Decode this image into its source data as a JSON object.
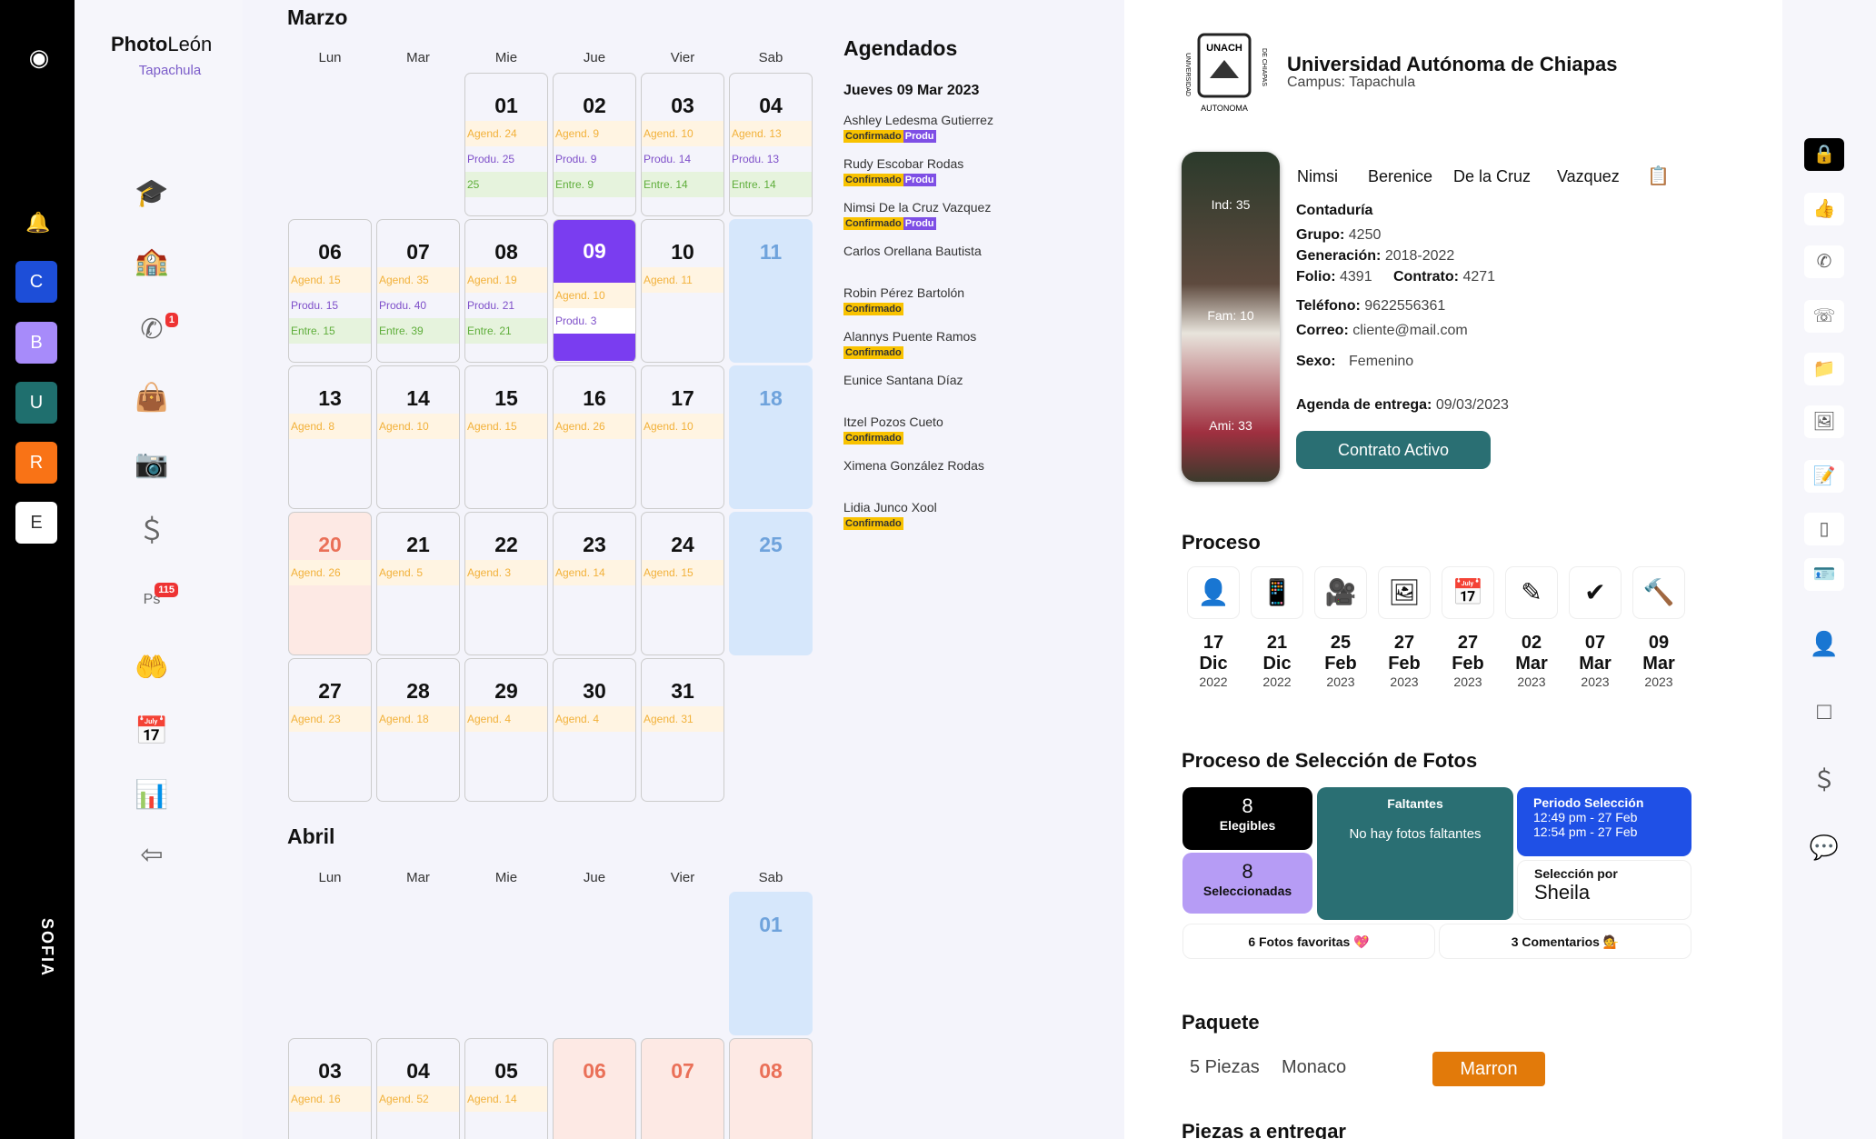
{
  "rail": {
    "logo_icon": "camera-lens-icon",
    "workspaces": [
      {
        "label": "C",
        "color": "#1d4ed8"
      },
      {
        "label": "B",
        "color": "#a78bfa"
      },
      {
        "label": "U",
        "color": "#1f6f6e"
      },
      {
        "label": "R",
        "color": "#f97316"
      },
      {
        "label": "E",
        "color": "#ffffff"
      }
    ],
    "user": "SOFIA"
  },
  "brand": {
    "name_bold": "Photo",
    "name_light": "León",
    "campus": "Tapachula"
  },
  "nav": {
    "whatsapp_badge": "1",
    "ps_badge": "115"
  },
  "calendar": {
    "march": {
      "title": "Marzo",
      "dows": [
        "Lun",
        "Mar",
        "Mie",
        "Jue",
        "Vier",
        "Sab"
      ],
      "weeks": [
        [
          null,
          null,
          {
            "d": "01",
            "lines": [
              [
                "ag",
                "Agend. 24"
              ],
              [
                "pr",
                "Produ. 25"
              ],
              [
                "en",
                "25"
              ]
            ]
          },
          {
            "d": "02",
            "lines": [
              [
                "ag",
                "Agend. 9"
              ],
              [
                "pr",
                "Produ. 9"
              ],
              [
                "en",
                "Entre. 9"
              ]
            ]
          },
          {
            "d": "03",
            "lines": [
              [
                "ag",
                "Agend. 10"
              ],
              [
                "pr",
                "Produ. 14"
              ],
              [
                "en",
                "Entre. 14"
              ]
            ]
          },
          {
            "d": "04",
            "lines": [
              [
                "ag",
                "Agend. 13"
              ],
              [
                "pr",
                "Produ. 13"
              ],
              [
                "en",
                "Entre. 14"
              ]
            ]
          }
        ],
        [
          {
            "d": "06",
            "lines": [
              [
                "ag",
                "Agend. 15"
              ],
              [
                "pr",
                "Produ. 15"
              ],
              [
                "en",
                "Entre. 15"
              ]
            ]
          },
          {
            "d": "07",
            "lines": [
              [
                "ag",
                "Agend. 35"
              ],
              [
                "pr",
                "Produ. 40"
              ],
              [
                "en",
                "Entre. 39"
              ]
            ]
          },
          {
            "d": "08",
            "lines": [
              [
                "ag",
                "Agend. 19"
              ],
              [
                "pr",
                "Produ. 21"
              ],
              [
                "en",
                "Entre. 21"
              ]
            ]
          },
          {
            "d": "09",
            "today": true,
            "lines": [
              [
                "ag",
                "Agend. 10"
              ],
              [
                "pr",
                "Produ. 3"
              ]
            ]
          },
          {
            "d": "10",
            "lines": [
              [
                "ag",
                "Agend. 11"
              ]
            ]
          },
          {
            "d": "11",
            "sat": true
          }
        ],
        [
          {
            "d": "13",
            "lines": [
              [
                "ag",
                "Agend. 8"
              ]
            ]
          },
          {
            "d": "14",
            "lines": [
              [
                "ag",
                "Agend. 10"
              ]
            ]
          },
          {
            "d": "15",
            "lines": [
              [
                "ag",
                "Agend. 15"
              ]
            ]
          },
          {
            "d": "16",
            "lines": [
              [
                "ag",
                "Agend. 26"
              ]
            ]
          },
          {
            "d": "17",
            "lines": [
              [
                "ag",
                "Agend. 10"
              ]
            ]
          },
          {
            "d": "18",
            "sat": true
          }
        ],
        [
          {
            "d": "20",
            "holiday": true,
            "lines": [
              [
                "ag",
                "Agend. 26"
              ]
            ]
          },
          {
            "d": "21",
            "lines": [
              [
                "ag",
                "Agend. 5"
              ]
            ]
          },
          {
            "d": "22",
            "lines": [
              [
                "ag",
                "Agend. 3"
              ]
            ]
          },
          {
            "d": "23",
            "lines": [
              [
                "ag",
                "Agend. 14"
              ]
            ]
          },
          {
            "d": "24",
            "lines": [
              [
                "ag",
                "Agend. 15"
              ]
            ]
          },
          {
            "d": "25",
            "sat": true
          }
        ],
        [
          {
            "d": "27",
            "lines": [
              [
                "ag",
                "Agend. 23"
              ]
            ]
          },
          {
            "d": "28",
            "lines": [
              [
                "ag",
                "Agend. 18"
              ]
            ]
          },
          {
            "d": "29",
            "lines": [
              [
                "ag",
                "Agend. 4"
              ]
            ]
          },
          {
            "d": "30",
            "lines": [
              [
                "ag",
                "Agend. 4"
              ]
            ]
          },
          {
            "d": "31",
            "lines": [
              [
                "ag",
                "Agend. 31"
              ]
            ]
          },
          null
        ]
      ]
    },
    "april": {
      "title": "Abril",
      "dows": [
        "Lun",
        "Mar",
        "Mie",
        "Jue",
        "Vier",
        "Sab"
      ],
      "weeks": [
        [
          null,
          null,
          null,
          null,
          null,
          {
            "d": "01",
            "sat": true
          }
        ],
        [
          {
            "d": "03",
            "lines": [
              [
                "ag",
                "Agend. 16"
              ]
            ]
          },
          {
            "d": "04",
            "lines": [
              [
                "ag",
                "Agend. 52"
              ]
            ]
          },
          {
            "d": "05",
            "lines": [
              [
                "ag",
                "Agend. 14"
              ]
            ]
          },
          {
            "d": "06",
            "holiday": true
          },
          {
            "d": "07",
            "holiday": true
          },
          {
            "d": "08",
            "holiday": true
          }
        ]
      ]
    }
  },
  "agenda": {
    "title": "Agendados",
    "date": "Jueves 09 Mar 2023",
    "items": [
      {
        "name": "Ashley Ledesma Gutierrez",
        "tags": [
          "Confirmado",
          "Produ"
        ]
      },
      {
        "name": "Rudy Escobar Rodas",
        "tags": [
          "Confirmado",
          "Produ"
        ]
      },
      {
        "name": "Nimsi De la Cruz Vazquez",
        "tags": [
          "Confirmado",
          "Produ"
        ]
      },
      {
        "name": "Carlos Orellana Bautista",
        "tags": []
      },
      {
        "name": "Robin Pérez Bartolón",
        "tags": [
          "Confirmado"
        ]
      },
      {
        "name": "Alannys Puente Ramos",
        "tags": [
          "Confirmado"
        ]
      },
      {
        "name": "Eunice Santana Díaz",
        "tags": []
      },
      {
        "name": "Itzel Pozos Cueto",
        "tags": [
          "Confirmado"
        ]
      },
      {
        "name": "Ximena González Rodas",
        "tags": []
      },
      {
        "name": "Lidia Junco Xool",
        "tags": [
          "Confirmado"
        ]
      }
    ]
  },
  "school": {
    "name": "Universidad Autónoma de Chiapas",
    "campus": "Campus: Tapachula",
    "seal_text": "UNACH",
    "seal_left": "UNIVERSIDAD",
    "seal_right": "DE CHIAPAS",
    "seal_bottom": "AUTONOMA"
  },
  "student": {
    "names": [
      "Nimsi",
      "Berenice",
      "De la Cruz",
      "Vazquez"
    ],
    "photo_labels": [
      "Ind: 35",
      "Fam: 10",
      "Ami: 33"
    ],
    "career": "Contaduría",
    "fields": [
      [
        "Grupo:",
        "4250"
      ],
      [
        "Generación:",
        "2018-2022"
      ]
    ],
    "folio_label": "Folio:",
    "folio": "4391",
    "contrato_label": "Contrato:",
    "contrato": "4271",
    "tel_label": "Teléfono:",
    "tel": "9622556361",
    "mail_label": "Correo:",
    "mail": "cliente@mail.com",
    "sexo_label": "Sexo:",
    "sexo": "Femenino",
    "agenda_label": "Agenda de entrega:",
    "agenda": "09/03/2023",
    "status": "Contrato Activo"
  },
  "process": {
    "title": "Proceso",
    "steps": [
      {
        "icon": "person-check-icon",
        "d": "17",
        "m": "Dic",
        "y": "2022"
      },
      {
        "icon": "phone-icon",
        "d": "21",
        "m": "Dic",
        "y": "2022"
      },
      {
        "icon": "photographer-icon",
        "d": "25",
        "m": "Feb",
        "y": "2023"
      },
      {
        "icon": "image-edit-icon",
        "d": "27",
        "m": "Feb",
        "y": "2023"
      },
      {
        "icon": "calendar-icon",
        "d": "27",
        "m": "Feb",
        "y": "2023"
      },
      {
        "icon": "edit-image-icon",
        "d": "02",
        "m": "Mar",
        "y": "2023"
      },
      {
        "icon": "verified-icon",
        "d": "07",
        "m": "Mar",
        "y": "2023"
      },
      {
        "icon": "hammer-icon",
        "d": "09",
        "m": "Mar",
        "y": "2023"
      }
    ]
  },
  "selection": {
    "title": "Proceso de Selección de Fotos",
    "eligible_n": "8",
    "eligible": "Elegibles",
    "selected_n": "8",
    "selected": "Seleccionadas",
    "missing_title": "Faltantes",
    "missing_text": "No hay fotos faltantes",
    "period_title": "Periodo Selección",
    "period_1": "12:49 pm - 27 Feb",
    "period_2": "12:54 pm - 27 Feb",
    "by_label": "Selección por",
    "by": "Sheila",
    "favs": "6 Fotos favoritas 💖",
    "comments": "3 Comentarios 💁"
  },
  "package": {
    "title": "Paquete",
    "pieces": "5 Piezas",
    "model": "Monaco",
    "color": "Marron",
    "color_hex": "#e27a0a"
  },
  "deliver": {
    "title": "Piezas a entregar"
  },
  "right_icons": [
    "lock-icon",
    "thumbs-up-icon",
    "whatsapp-icon",
    "whatsapp-outline-icon",
    "folder-icon",
    "image-icon",
    "document-icon",
    "tablet-icon",
    "contact-card-icon",
    "user-icon",
    "square-icon",
    "dollar-icon",
    "chat-icon"
  ]
}
